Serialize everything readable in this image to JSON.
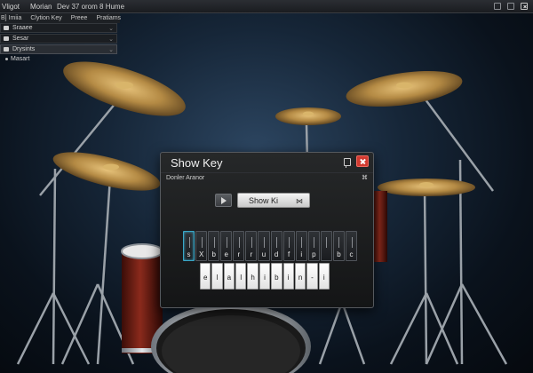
{
  "menubar": {
    "items": [
      "Vligot",
      "Morian"
    ],
    "title": "Dev 37 orom 8 Hume",
    "win_buttons": [
      "minimize-icon",
      "maximize-icon",
      "close-icon"
    ]
  },
  "tabbar": {
    "items": [
      "B] Imiia",
      "Clytion Key",
      "Preee",
      "Pratiams"
    ]
  },
  "sidebar": {
    "items": [
      {
        "label": "Sraaee",
        "icon": "drum-icon"
      },
      {
        "label": "Sesar",
        "icon": "drum-icon"
      },
      {
        "label": "Drysints",
        "icon": "drum-icon"
      }
    ],
    "sub_label": "Masart"
  },
  "dialog": {
    "title": "Show Key",
    "subtitle": "Donler Aranor",
    "showkey_button": "Show Ki",
    "showkey_button_icon": "⋈",
    "icons": [
      "pin-icon",
      "close-icon",
      "options-icon",
      "play-icon"
    ],
    "keys_top": [
      "s",
      "X",
      "b",
      "e",
      "r",
      "r",
      "u",
      "d",
      "f",
      "i",
      "p",
      " ",
      "b",
      "c"
    ],
    "keys_bottom": [
      "e",
      "l",
      "a",
      "l",
      "h",
      "i",
      "b",
      "i",
      "n",
      "-",
      "i"
    ],
    "close_color": "#d23a30"
  }
}
